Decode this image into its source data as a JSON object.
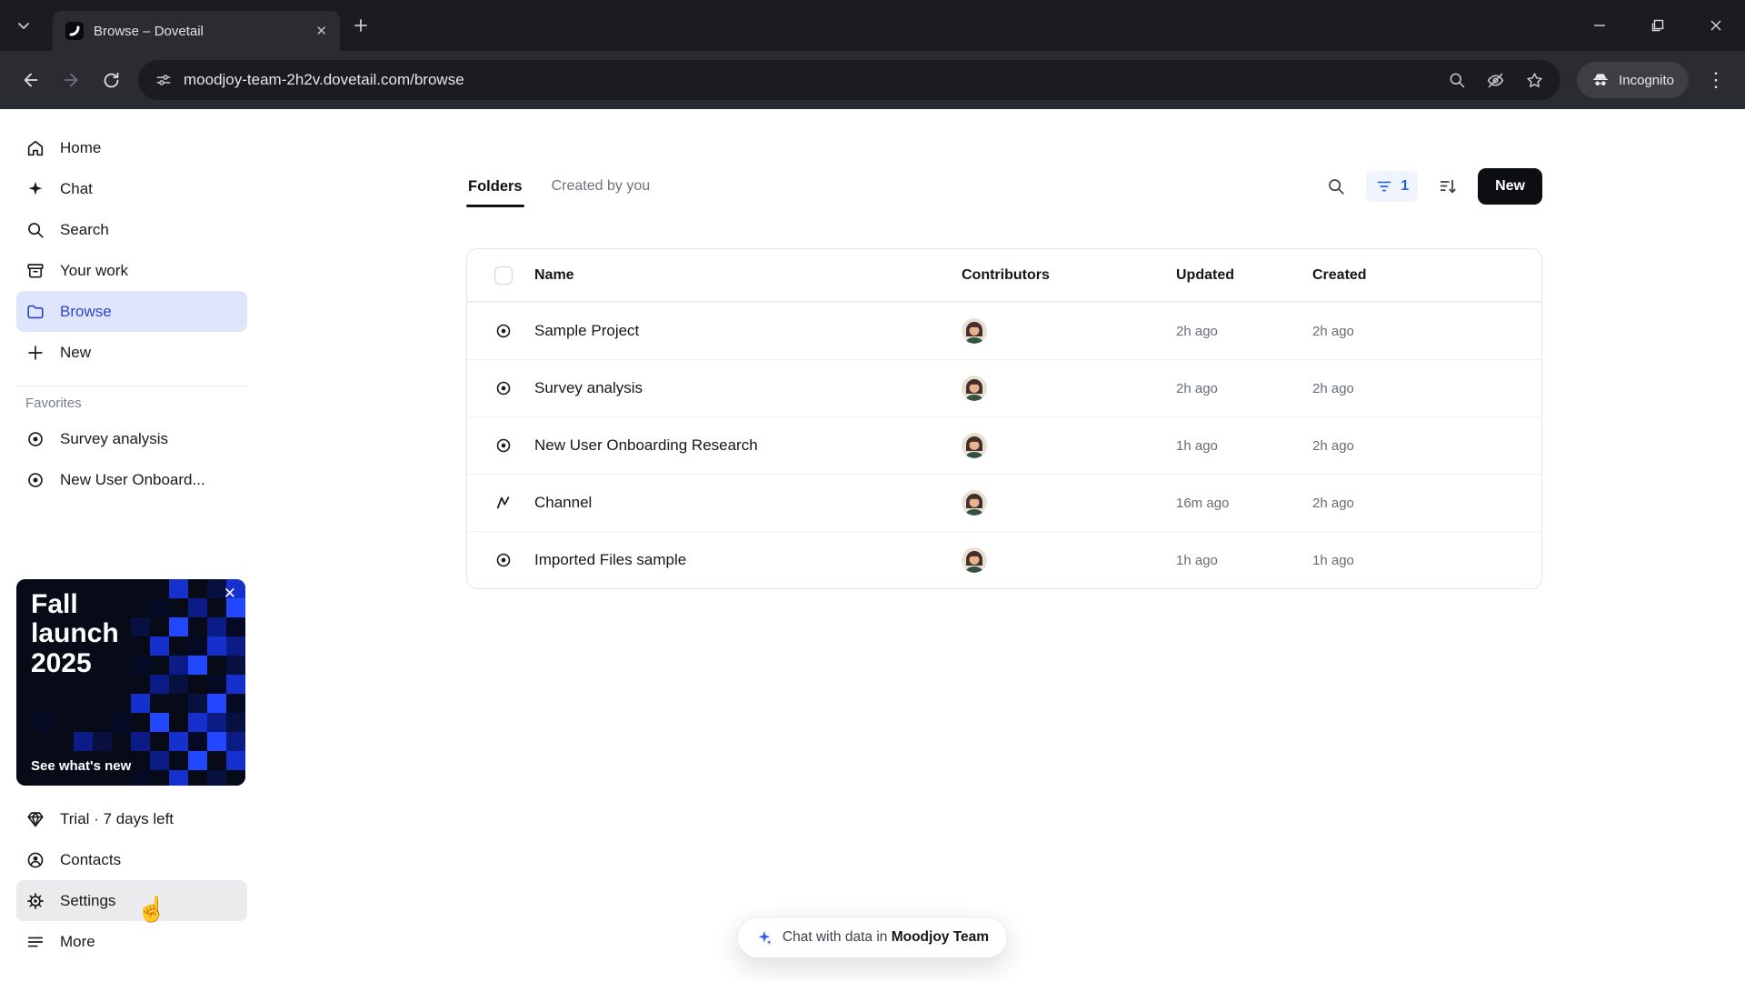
{
  "colors": {
    "accent": "#2563eb",
    "sidebar_active": "#dfe6fb",
    "new_button_bg": "#0d0e12",
    "promo_bg": "#070b18"
  },
  "browser": {
    "tab_title": "Browse – Dovetail",
    "url": "moodjoy-team-2h2v.dovetail.com/browse",
    "incognito_label": "Incognito"
  },
  "sidebar": {
    "items": [
      {
        "label": "Home",
        "icon": "home-icon"
      },
      {
        "label": "Chat",
        "icon": "sparkle-icon"
      },
      {
        "label": "Search",
        "icon": "search-icon"
      },
      {
        "label": "Your work",
        "icon": "archive-icon"
      },
      {
        "label": "Browse",
        "icon": "folder-icon",
        "active": true
      },
      {
        "label": "New",
        "icon": "plus-icon"
      }
    ],
    "favorites_label": "Favorites",
    "favorites": [
      {
        "label": "Survey analysis",
        "icon": "circle-dot-icon"
      },
      {
        "label": "New User Onboard...",
        "icon": "circle-dot-icon"
      }
    ],
    "promo": {
      "title": "Fall launch 2025",
      "link": "See what's new",
      "close": "✕"
    },
    "footer": [
      {
        "label": "Trial · 7 days left",
        "icon": "gem-icon"
      },
      {
        "label": "Contacts",
        "icon": "person-icon"
      },
      {
        "label": "Settings",
        "icon": "gear-icon",
        "hover": true
      },
      {
        "label": "More",
        "icon": "menu-icon"
      }
    ]
  },
  "main": {
    "tabs": [
      {
        "label": "Folders",
        "active": true
      },
      {
        "label": "Created by you"
      }
    ],
    "controls": {
      "filter_count": "1",
      "new_label": "New"
    },
    "table": {
      "headers": [
        "Name",
        "Contributors",
        "Updated",
        "Created"
      ],
      "rows": [
        {
          "name": "Sample Project",
          "icon": "project-icon",
          "updated": "2h ago",
          "created": "2h ago"
        },
        {
          "name": "Survey analysis",
          "icon": "project-icon",
          "updated": "2h ago",
          "created": "2h ago"
        },
        {
          "name": "New User Onboarding Research",
          "icon": "project-icon",
          "updated": "1h ago",
          "created": "2h ago"
        },
        {
          "name": "Channel",
          "icon": "channel-icon",
          "updated": "16m ago",
          "created": "2h ago"
        },
        {
          "name": "Imported Files sample",
          "icon": "project-icon",
          "updated": "1h ago",
          "created": "1h ago"
        }
      ]
    },
    "chat_pill": {
      "prefix": "Chat with data in",
      "team": "Moodjoy Team"
    }
  }
}
